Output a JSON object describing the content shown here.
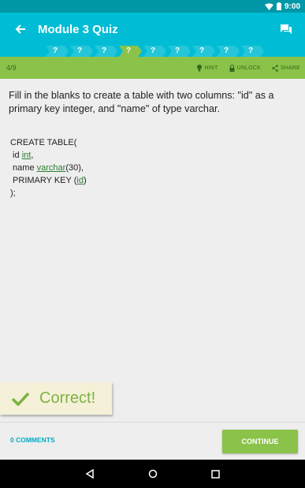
{
  "status": {
    "time": "9:00"
  },
  "header": {
    "title": "Module 3 Quiz"
  },
  "steps": [
    "?",
    "?",
    "?",
    "?",
    "?",
    "?",
    "?",
    "?",
    "?"
  ],
  "toolbar": {
    "counter": "4/9",
    "hint_label": "HINT",
    "unlock_label": "UNLOCK",
    "share_label": "SHARE"
  },
  "question": {
    "text": "Fill in the blanks to create a table with two columns: \"id\" as a primary key integer, and \"name\" of type varchar."
  },
  "code": {
    "l1": "CREATE TABLE(",
    "l2_pre": " id ",
    "l2_blank": "int",
    "l2_post": ",",
    "l3_pre": " name ",
    "l3_blank": "varchar",
    "l3_post": "(30),",
    "l4_pre": " PRIMARY KEY (",
    "l4_blank": "id",
    "l4_post": ")",
    "l5": ");"
  },
  "feedback": {
    "text": "Correct!"
  },
  "footer": {
    "comments_label": "0 COMMENTS",
    "continue_label": "CONTINUE"
  },
  "colors": {
    "primary": "#00bcd4",
    "primary_dark": "#0097a7",
    "accent": "#8bc34a",
    "correct": "#7cb342",
    "link": "#00acc1"
  }
}
